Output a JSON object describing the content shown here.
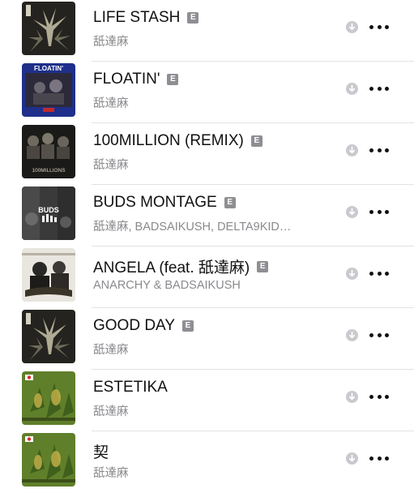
{
  "tracks": [
    {
      "title": "LIFE STASH",
      "explicit": true,
      "artist": "舐達麻",
      "art": "leaf-dark"
    },
    {
      "title": "FLOATIN'",
      "explicit": true,
      "artist": "舐達麻",
      "art": "floatin",
      "art_text": "FLOATIN'"
    },
    {
      "title": "100MILLION (REMIX)",
      "explicit": true,
      "artist": "舐達麻",
      "art": "group-dark",
      "art_text": "100MILLIONS"
    },
    {
      "title": "BUDS MONTAGE",
      "explicit": true,
      "artist": "舐達麻, BADSAIKUSH, DELTA9KID…",
      "art": "buds",
      "art_text": "BUDS"
    },
    {
      "title": "ANGELA (feat. 舐達麻)",
      "explicit": true,
      "artist": "ANARCHY & BADSAIKUSH",
      "art": "angela"
    },
    {
      "title": "GOOD DAY",
      "explicit": true,
      "artist": "舐達麻",
      "art": "leaf-dark"
    },
    {
      "title": "ESTETIKA",
      "explicit": false,
      "artist": "舐達麻",
      "art": "leaf-green"
    },
    {
      "title": "契",
      "explicit": false,
      "artist": "舐達麻",
      "art": "leaf-green"
    }
  ],
  "explicit_badge": "E",
  "icons": {
    "download": "download-arrow-icon",
    "more": "more-ellipsis-icon"
  },
  "colors": {
    "title": "#111111",
    "subtitle": "#8a8a8e",
    "badge": "#8e8e93",
    "separator": "#e3e3e6"
  }
}
